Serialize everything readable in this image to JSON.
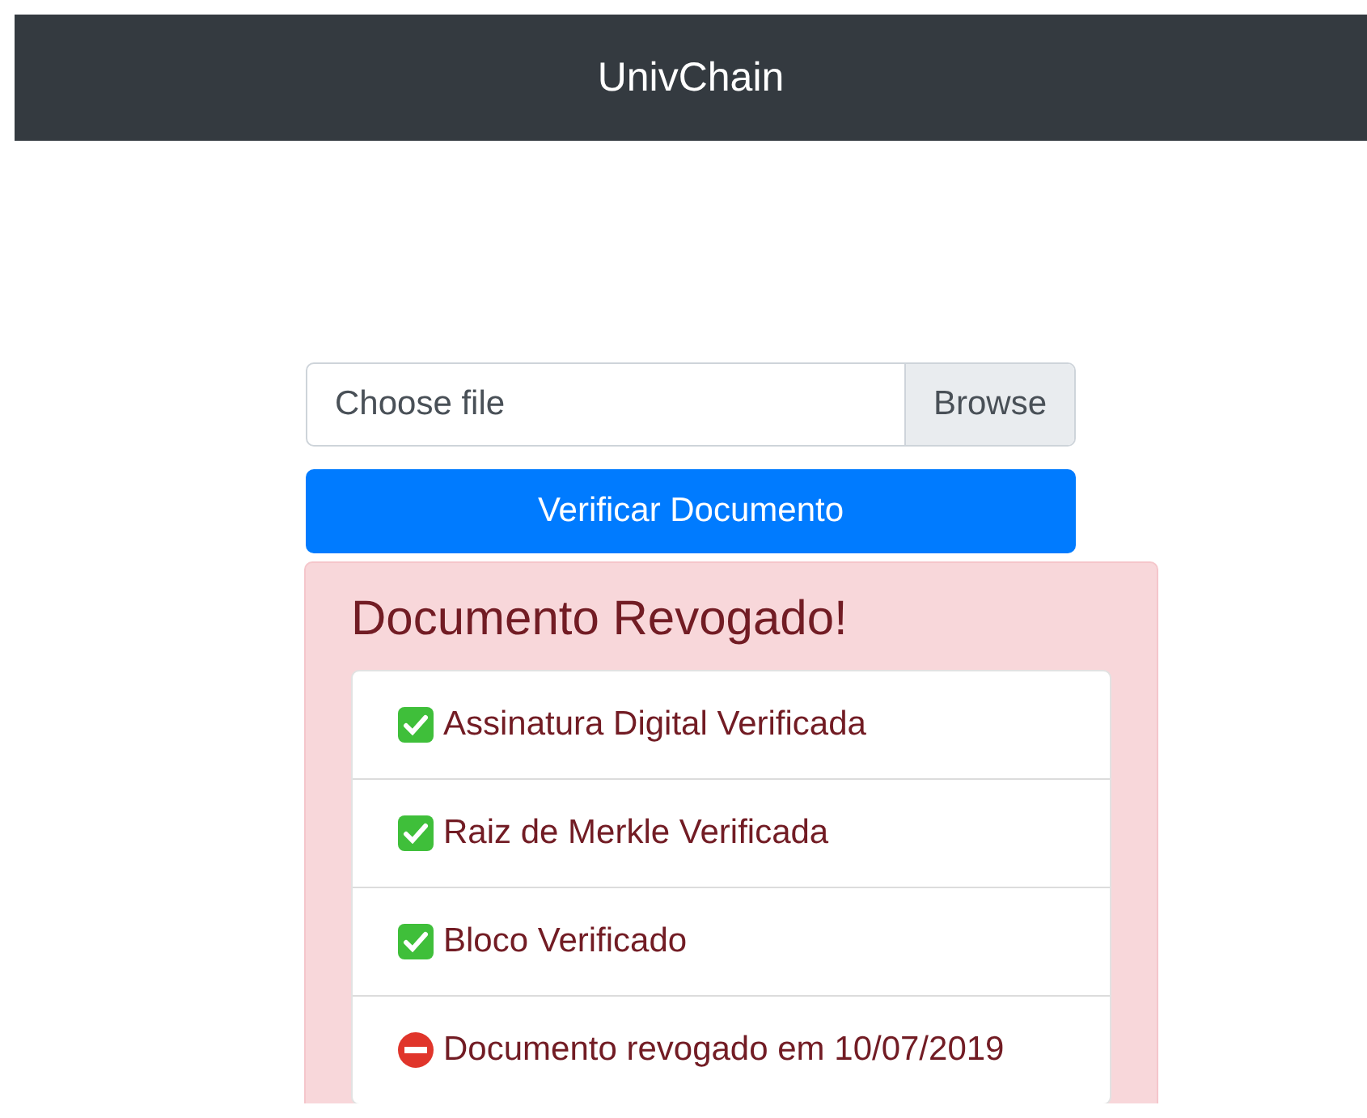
{
  "navbar": {
    "brand": "UnivChain"
  },
  "file_input": {
    "placeholder": "Choose file",
    "browse_label": "Browse"
  },
  "verify_button": "Verificar Documento",
  "alert": {
    "title": "Documento Revogado!",
    "checks": [
      {
        "kind": "verified",
        "text": "Assinatura Digital Verificada"
      },
      {
        "kind": "verified",
        "text": "Raiz de Merkle Verificada"
      },
      {
        "kind": "verified",
        "text": "Bloco Verificado"
      },
      {
        "kind": "revoked",
        "text": "Documento revogado em 10/07/2019"
      }
    ]
  }
}
